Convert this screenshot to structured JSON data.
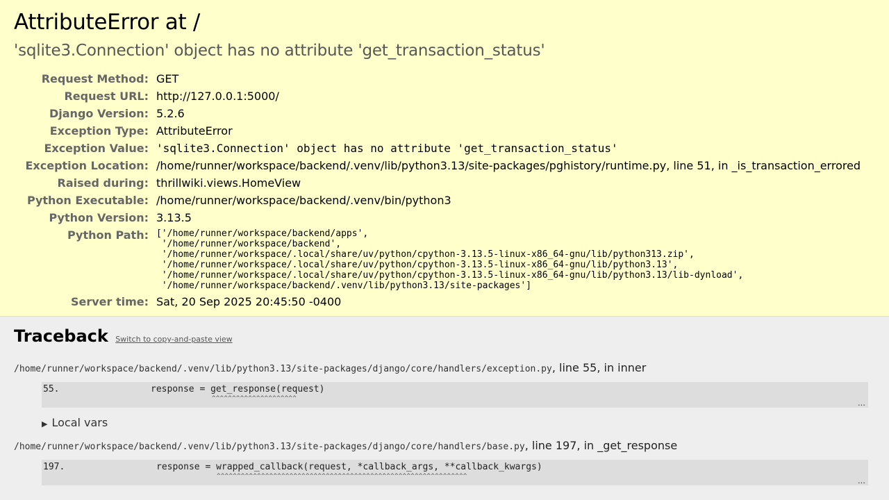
{
  "summary": {
    "title": "AttributeError at /",
    "message": "'sqlite3.Connection' object has no attribute 'get_transaction_status'",
    "rows": [
      {
        "label": "Request Method:",
        "value": "GET"
      },
      {
        "label": "Request URL:",
        "value": "http://127.0.0.1:5000/"
      },
      {
        "label": "Django Version:",
        "value": "5.2.6"
      },
      {
        "label": "Exception Type:",
        "value": "AttributeError"
      },
      {
        "label": "Exception Value:",
        "value": "'sqlite3.Connection' object has no attribute 'get_transaction_status'"
      },
      {
        "label": "Exception Location:",
        "value": "/home/runner/workspace/backend/.venv/lib/python3.13/site-packages/pghistory/runtime.py, line 51, in _is_transaction_errored"
      },
      {
        "label": "Raised during:",
        "value": "thrillwiki.views.HomeView"
      },
      {
        "label": "Python Executable:",
        "value": "/home/runner/workspace/backend/.venv/bin/python3"
      },
      {
        "label": "Python Version:",
        "value": "3.13.5"
      },
      {
        "label": "Python Path:",
        "value": "['/home/runner/workspace/backend/apps',\n '/home/runner/workspace/backend',\n '/home/runner/workspace/.local/share/uv/python/cpython-3.13.5-linux-x86_64-gnu/lib/python313.zip',\n '/home/runner/workspace/.local/share/uv/python/cpython-3.13.5-linux-x86_64-gnu/lib/python3.13',\n '/home/runner/workspace/.local/share/uv/python/cpython-3.13.5-linux-x86_64-gnu/lib/python3.13/lib-dynload',\n '/home/runner/workspace/backend/.venv/lib/python3.13/site-packages']"
      },
      {
        "label": "Server time:",
        "value": "Sat, 20 Sep 2025 20:45:50 -0400"
      }
    ]
  },
  "traceback": {
    "title": "Traceback",
    "switch_link": "Switch to copy-and-paste view",
    "local_vars_label": "Local vars",
    "ellipsis": "…",
    "frames": [
      {
        "file": "/home/runner/workspace/backend/.venv/lib/python3.13/site-packages/django/core/handlers/exception.py",
        "location": ", line 55, in inner",
        "lineno": "55.",
        "code": "response = get_response(request)",
        "carets": "^^^^^^^^^^^^^^^^^^^^^"
      },
      {
        "file": "/home/runner/workspace/backend/.venv/lib/python3.13/site-packages/django/core/handlers/base.py",
        "location": ", line 197, in _get_response",
        "lineno": "197.",
        "code": "response = wrapped_callback(request, *callback_args, **callback_kwargs)",
        "carets": "^^^^^^^^^^^^^^^^^^^^^^^^^^^^^^^^^^^^^^^^^^^^^^^^^^^^^^^^^^^^^^"
      }
    ]
  }
}
